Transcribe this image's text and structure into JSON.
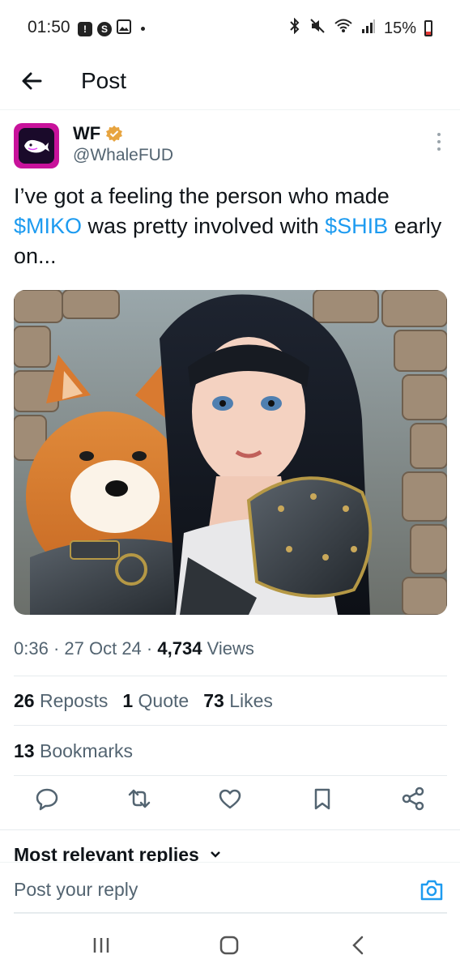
{
  "status_bar": {
    "time": "01:50",
    "battery": "15%",
    "left_icons": [
      "alert-icon",
      "s-icon",
      "image-icon"
    ],
    "right_icons": [
      "bluetooth-icon",
      "mute-icon",
      "wifi-icon",
      "signal-icon",
      "battery-icon"
    ]
  },
  "header": {
    "title": "Post",
    "back_icon": "arrow-left-icon"
  },
  "author": {
    "name": "WF",
    "handle": "@WhaleFUD",
    "verified_color": "#e7a43f"
  },
  "tweet": {
    "text_part1": "I’ve got a feeling the person who made ",
    "cashtag1": "$MIKO",
    "text_part2": " was pretty involved with ",
    "cashtag2": "$SHIB",
    "text_part3": " early on...",
    "cashtag_color": "#1d9bf0"
  },
  "meta": {
    "time": "0:36",
    "sep1": "·",
    "date": "27 Oct 24",
    "sep2": "·",
    "views_count": "4,734",
    "views_label": "Views"
  },
  "stats": {
    "reposts_count": "26",
    "reposts_label": "Reposts",
    "quotes_count": "1",
    "quotes_label": "Quote",
    "likes_count": "73",
    "likes_label": "Likes",
    "bookmarks_count": "13",
    "bookmarks_label": "Bookmarks"
  },
  "actions": [
    "reply-icon",
    "repost-icon",
    "like-icon",
    "bookmark-icon",
    "share-icon"
  ],
  "replies": {
    "sort_label": "Most relevant replies"
  },
  "reply_box": {
    "placeholder": "Post your reply"
  },
  "nav_icons": [
    "recent-apps-icon",
    "home-icon",
    "back-icon"
  ]
}
